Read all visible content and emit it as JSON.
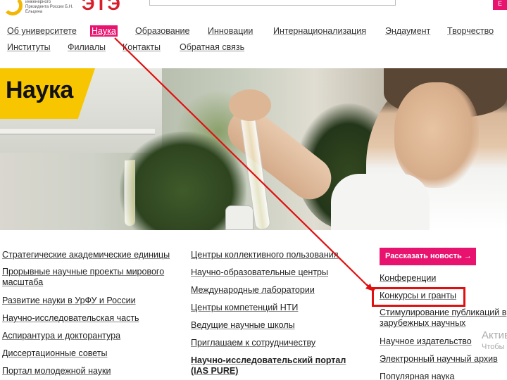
{
  "header": {
    "logo_text": "инженерного Президента России Б.Н. Ельцина",
    "logo_big": "ЭТЭ",
    "top_square": "Е"
  },
  "nav": {
    "row1": [
      "Об университете",
      "Наука",
      "Образование",
      "Инновации",
      "Интернационализация",
      "Эндаумент",
      "Творчество"
    ],
    "row2": [
      "Институты",
      "Филиалы",
      "Контакты",
      "Обратная связь"
    ],
    "active": "Наука",
    "active_color": "#e8136f"
  },
  "hero": {
    "title": "Наука",
    "title_bg_color": "#f7c600"
  },
  "columns": {
    "col1": [
      "Стратегические академические единицы",
      "Прорывные научные проекты мирового масштаба",
      "Развитие науки в УрФУ и России",
      "Научно-исследовательская часть",
      "Аспирантура и докторантура",
      "Диссертационные советы",
      "Портал молодежной науки"
    ],
    "col2": [
      "Центры коллективного пользования",
      "Научно-образовательные центры",
      "Международные лаборатории",
      "Центры компетенций НТИ",
      "Ведущие научные школы",
      "Приглашаем к сотрудничеству",
      "Научно-исследовательский портал (IAS PURE)"
    ],
    "col3_button": "Рассказать новость →",
    "col3": [
      "Конференции",
      "Конкурсы и гранты",
      "Стимулирование публикаций в зарубежных научных издательствах",
      "Научное издательство",
      "Электронный научный архив",
      "Популярная наука"
    ]
  },
  "annotation": {
    "highlighted_item": "Конкурсы и гранты",
    "highlight_color": "#e01010"
  },
  "overlay": {
    "activation_title": "Активация Windows",
    "activation_subtitle": "Чтобы активировать Windows"
  }
}
